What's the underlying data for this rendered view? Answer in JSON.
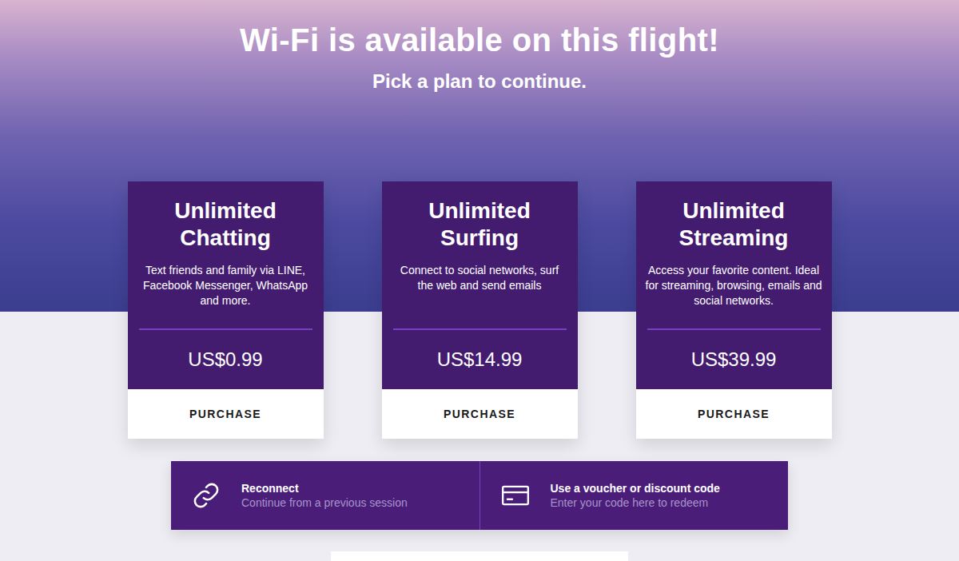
{
  "header": {
    "title": "Wi-Fi is available on this flight!",
    "subtitle": "Pick a plan to continue."
  },
  "plans": [
    {
      "name": "Unlimited Chatting",
      "description": "Text friends and family via LINE, Facebook Messenger, WhatsApp and more.",
      "price": "US$0.99",
      "button": "PURCHASE"
    },
    {
      "name": "Unlimited Surfing",
      "description": "Connect to social networks, surf the web and send emails",
      "price": "US$14.99",
      "button": "PURCHASE"
    },
    {
      "name": "Unlimited Streaming",
      "description": "Access your favorite content. Ideal for streaming, browsing, emails and social networks.",
      "price": "US$39.99",
      "button": "PURCHASE"
    }
  ],
  "options": [
    {
      "title": "Reconnect",
      "subtitle": "Continue from a previous session",
      "kind": "link"
    },
    {
      "title": "Use a voucher or discount code",
      "subtitle": "Enter your code here to redeem",
      "kind": "card"
    }
  ]
}
